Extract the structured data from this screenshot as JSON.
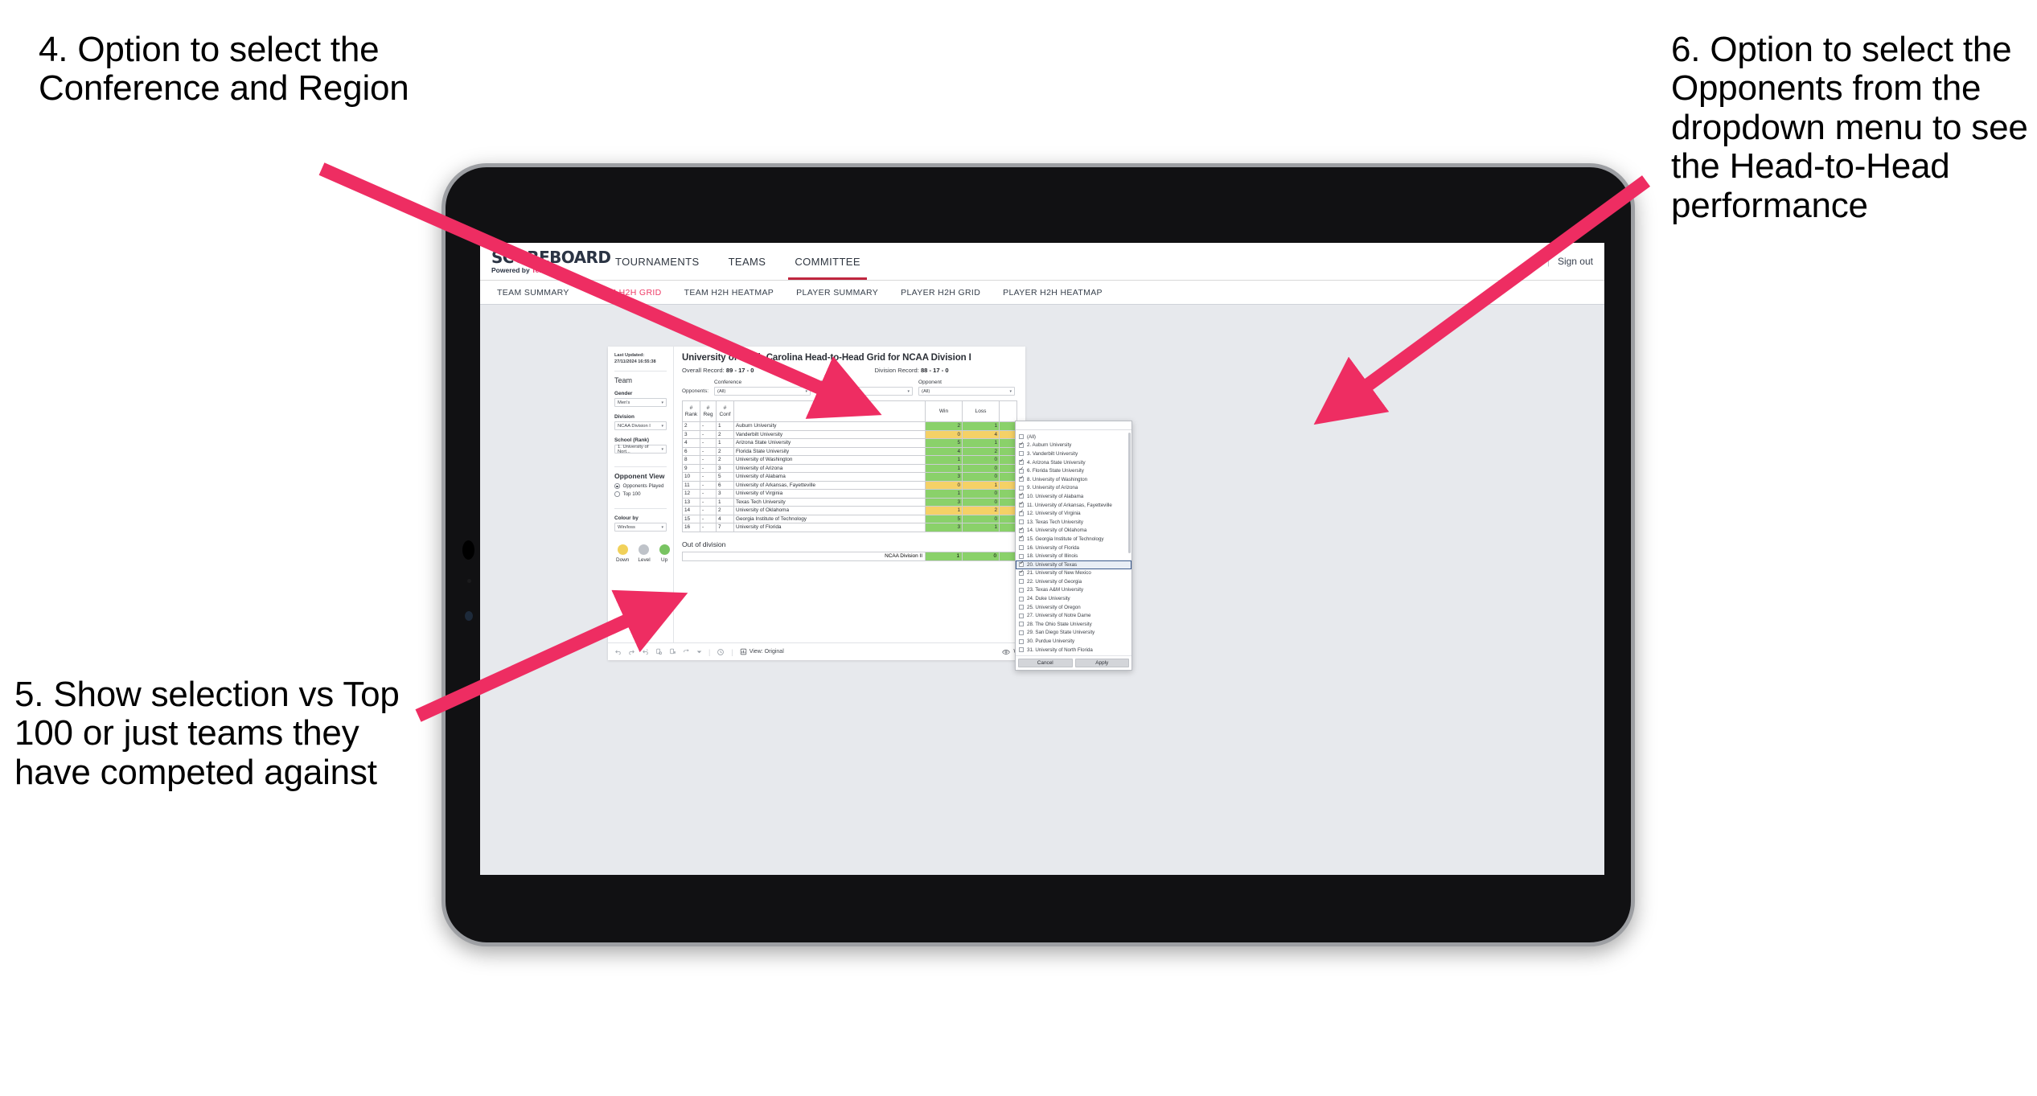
{
  "annotations": [
    {
      "id": "4",
      "text": "4. Option to select the Conference and Region"
    },
    {
      "id": "5",
      "text": "5. Show selection vs Top 100 or just teams they have competed against"
    },
    {
      "id": "6",
      "text": "6. Option to select the Opponents from the dropdown menu to see the Head-to-Head performance"
    }
  ],
  "colors": {
    "accent_pink": "#ee3a65",
    "arrow_pink": "#ee2d62",
    "win_green": "#8ad16a",
    "loss_yellow": "#f5d166",
    "level_grey": "#bfc3c9",
    "active_tab_underline": "#c0263f"
  },
  "app": {
    "brand": {
      "name": "SCOREBOARD",
      "tagline_prefix": "Powered by ",
      "tagline_brand": "Tennis"
    },
    "top_nav": [
      {
        "label": "TOURNAMENTS",
        "active": false
      },
      {
        "label": "TEAMS",
        "active": false
      },
      {
        "label": "COMMITTEE",
        "active": true
      }
    ],
    "header_right": {
      "divider": "|",
      "sign_out": "Sign out"
    },
    "sub_nav": [
      {
        "label": "TEAM SUMMARY",
        "active": false
      },
      {
        "label": "TEAM H2H GRID",
        "active": true
      },
      {
        "label": "TEAM H2H HEATMAP",
        "active": false
      },
      {
        "label": "PLAYER SUMMARY",
        "active": false
      },
      {
        "label": "PLAYER H2H GRID",
        "active": false
      },
      {
        "label": "PLAYER H2H HEATMAP",
        "active": false
      }
    ]
  },
  "rail": {
    "last_updated": "Last Updated: 27/11/2024 16:55:38",
    "team_heading": "Team",
    "gender_label": "Gender",
    "gender_value": "Men's",
    "division_label": "Division",
    "division_value": "NCAA Division I",
    "school_label": "School (Rank)",
    "school_value": "1. University of Nort...",
    "opponent_view_heading": "Opponent View",
    "opponent_view_options": [
      {
        "label": "Opponents Played",
        "selected": true
      },
      {
        "label": "Top 100",
        "selected": false
      }
    ],
    "colour_by_label": "Colour by",
    "colour_by_value": "Win/loss",
    "legend": [
      {
        "label": "Down",
        "color": "#f1d15a"
      },
      {
        "label": "Level",
        "color": "#bfc3c9"
      },
      {
        "label": "Up",
        "color": "#79c462"
      }
    ]
  },
  "sheet": {
    "title": "University of North Carolina Head-to-Head Grid for NCAA Division I",
    "overall_record_label": "Overall Record:",
    "overall_record_value": "89 - 17 - 0",
    "division_record_label": "Division Record:",
    "division_record_value": "88 - 17 - 0",
    "opponents_label": "Opponents:",
    "filters": [
      {
        "caption": "Conference",
        "value": "(All)"
      },
      {
        "caption": "Region",
        "value": "(All)"
      },
      {
        "caption": "Opponent",
        "value": "(All)"
      }
    ],
    "out_of_division_caption": "Out of division",
    "out_of_division_row": {
      "name": "NCAA Division II",
      "win": "1",
      "loss": "0"
    }
  },
  "chart_data": {
    "type": "table",
    "title": "University of North Carolina Head-to-Head Grid for NCAA Division I",
    "columns": [
      "# Rank",
      "# Reg",
      "# Conf",
      "Opponent",
      "Win",
      "Loss",
      ""
    ],
    "column_header_lines": [
      [
        "#",
        "Rank"
      ],
      [
        "#",
        "Reg"
      ],
      [
        "#",
        "Conf"
      ],
      [
        "Opponent"
      ],
      [
        "Win"
      ],
      [
        "Loss"
      ],
      [
        ""
      ]
    ],
    "rows": [
      {
        "rank": "2",
        "reg": "-",
        "conf": "1",
        "opponent": "Auburn University",
        "win": "2",
        "loss": "1",
        "state": "win"
      },
      {
        "rank": "3",
        "reg": "-",
        "conf": "2",
        "opponent": "Vanderbilt University",
        "win": "0",
        "loss": "4",
        "state": "loss"
      },
      {
        "rank": "4",
        "reg": "-",
        "conf": "1",
        "opponent": "Arizona State University",
        "win": "5",
        "loss": "1",
        "state": "win"
      },
      {
        "rank": "6",
        "reg": "-",
        "conf": "2",
        "opponent": "Florida State University",
        "win": "4",
        "loss": "2",
        "state": "win"
      },
      {
        "rank": "8",
        "reg": "-",
        "conf": "2",
        "opponent": "University of Washington",
        "win": "1",
        "loss": "0",
        "state": "win"
      },
      {
        "rank": "9",
        "reg": "-",
        "conf": "3",
        "opponent": "University of Arizona",
        "win": "1",
        "loss": "0",
        "state": "win"
      },
      {
        "rank": "10",
        "reg": "-",
        "conf": "5",
        "opponent": "University of Alabama",
        "win": "3",
        "loss": "0",
        "state": "win"
      },
      {
        "rank": "11",
        "reg": "-",
        "conf": "6",
        "opponent": "University of Arkansas, Fayetteville",
        "win": "0",
        "loss": "1",
        "state": "loss"
      },
      {
        "rank": "12",
        "reg": "-",
        "conf": "3",
        "opponent": "University of Virginia",
        "win": "1",
        "loss": "0",
        "state": "win"
      },
      {
        "rank": "13",
        "reg": "-",
        "conf": "1",
        "opponent": "Texas Tech University",
        "win": "3",
        "loss": "0",
        "state": "win"
      },
      {
        "rank": "14",
        "reg": "-",
        "conf": "2",
        "opponent": "University of Oklahoma",
        "win": "1",
        "loss": "2",
        "state": "loss"
      },
      {
        "rank": "15",
        "reg": "-",
        "conf": "4",
        "opponent": "Georgia Institute of Technology",
        "win": "5",
        "loss": "0",
        "state": "win"
      },
      {
        "rank": "16",
        "reg": "-",
        "conf": "7",
        "opponent": "University of Florida",
        "win": "3",
        "loss": "1",
        "state": "win"
      }
    ],
    "legend": [
      {
        "label": "Down",
        "color": "#f1d15a"
      },
      {
        "label": "Level",
        "color": "#bfc3c9"
      },
      {
        "label": "Up",
        "color": "#79c462"
      }
    ]
  },
  "opponent_popup": {
    "options": [
      {
        "label": "(All)",
        "checked": false,
        "selected": false
      },
      {
        "label": "2. Auburn University",
        "checked": true,
        "selected": false
      },
      {
        "label": "3. Vanderbilt University",
        "checked": false,
        "selected": false
      },
      {
        "label": "4. Arizona State University",
        "checked": true,
        "selected": false
      },
      {
        "label": "6. Florida State University",
        "checked": true,
        "selected": false
      },
      {
        "label": "8. University of Washington",
        "checked": true,
        "selected": false
      },
      {
        "label": "9. University of Arizona",
        "checked": false,
        "selected": false
      },
      {
        "label": "10. University of Alabama",
        "checked": true,
        "selected": false
      },
      {
        "label": "11. University of Arkansas, Fayetteville",
        "checked": true,
        "selected": false
      },
      {
        "label": "12. University of Virginia",
        "checked": true,
        "selected": false
      },
      {
        "label": "13. Texas Tech University",
        "checked": false,
        "selected": false
      },
      {
        "label": "14. University of Oklahoma",
        "checked": true,
        "selected": false
      },
      {
        "label": "15. Georgia Institute of Technology",
        "checked": true,
        "selected": false
      },
      {
        "label": "16. University of Florida",
        "checked": false,
        "selected": false
      },
      {
        "label": "18. University of Illinois",
        "checked": false,
        "selected": false
      },
      {
        "label": "20. University of Texas",
        "checked": true,
        "selected": true
      },
      {
        "label": "21. University of New Mexico",
        "checked": true,
        "selected": false
      },
      {
        "label": "22. University of Georgia",
        "checked": false,
        "selected": false
      },
      {
        "label": "23. Texas A&M University",
        "checked": false,
        "selected": false
      },
      {
        "label": "24. Duke University",
        "checked": false,
        "selected": false
      },
      {
        "label": "25. University of Oregon",
        "checked": false,
        "selected": false
      },
      {
        "label": "27. University of Notre Dame",
        "checked": false,
        "selected": false
      },
      {
        "label": "28. The Ohio State University",
        "checked": false,
        "selected": false
      },
      {
        "label": "29. San Diego State University",
        "checked": false,
        "selected": false
      },
      {
        "label": "30. Purdue University",
        "checked": false,
        "selected": false
      },
      {
        "label": "31. University of North Florida",
        "checked": false,
        "selected": false
      }
    ],
    "cancel_label": "Cancel",
    "apply_label": "Apply"
  },
  "toolbar": {
    "view_label": "View: Original",
    "right_label": "W"
  }
}
